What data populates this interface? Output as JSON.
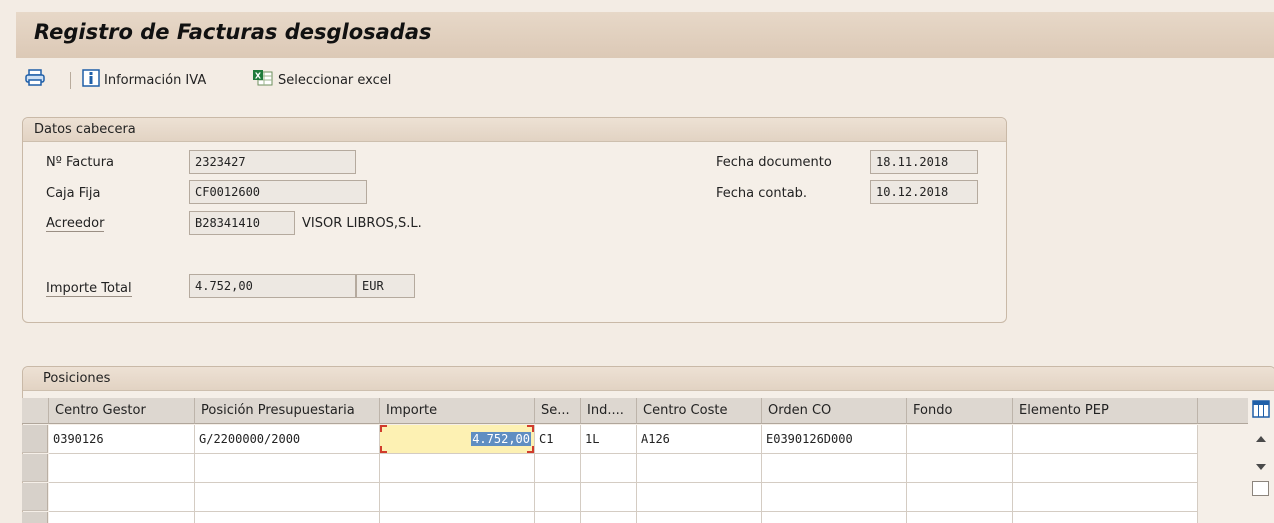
{
  "title": "Registro de Facturas desglosadas",
  "toolbar": {
    "info_iva": "Información IVA",
    "select_excel": "Seleccionar excel"
  },
  "header": {
    "group_title": "Datos cabecera",
    "nro_factura_label": "Nº Factura",
    "nro_factura_value": "2323427",
    "caja_fija_label": "Caja Fija",
    "caja_fija_value": "CF0012600",
    "acreedor_label": "Acreedor",
    "acreedor_value": "B28341410",
    "acreedor_name": "VISOR LIBROS,S.L.",
    "importe_total_label": "Importe Total",
    "importe_total_value": "4.752,00",
    "currency": "EUR",
    "fecha_doc_label": "Fecha documento",
    "fecha_doc_value": "18.11.2018",
    "fecha_contab_label": "Fecha contab.",
    "fecha_contab_value": "10.12.2018"
  },
  "positions": {
    "group_title": "Posiciones",
    "columns": [
      "Centro Gestor",
      "Posición Presupuestaria",
      "Importe",
      "Se...",
      "Ind....",
      "Centro Coste",
      "Orden CO",
      "Fondo",
      "Elemento PEP"
    ],
    "rows": [
      [
        "0390126",
        "G/2200000/2000",
        "4.752,00",
        "C1",
        "1L",
        "A126",
        "E0390126D000",
        "",
        ""
      ],
      [
        "",
        "",
        "",
        "",
        "",
        "",
        "",
        "",
        ""
      ],
      [
        "",
        "",
        "",
        "",
        "",
        "",
        "",
        "",
        ""
      ],
      [
        "",
        "",
        "",
        "",
        "",
        "",
        "",
        "",
        ""
      ]
    ]
  },
  "colors": {
    "title_bg": "#dcc9b6",
    "active_cell": "#fdf1b3",
    "selection": "#5f8ec2",
    "focus_corner": "#d13c2c"
  },
  "icons": [
    "print-icon",
    "info-icon",
    "excel-icon",
    "column-layout-icon",
    "scroll-up-icon",
    "scroll-down-icon"
  ]
}
